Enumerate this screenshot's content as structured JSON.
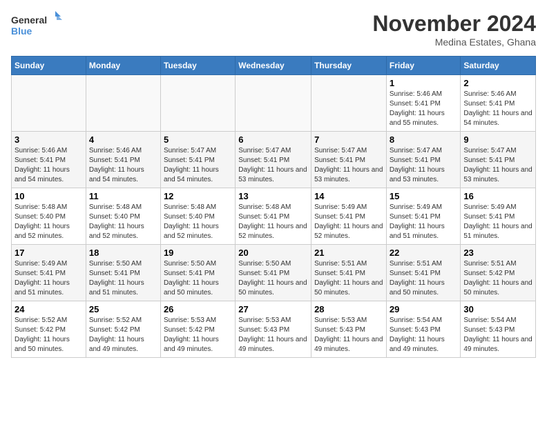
{
  "logo": {
    "line1": "General",
    "line2": "Blue"
  },
  "title": "November 2024",
  "subtitle": "Medina Estates, Ghana",
  "days_header": [
    "Sunday",
    "Monday",
    "Tuesday",
    "Wednesday",
    "Thursday",
    "Friday",
    "Saturday"
  ],
  "weeks": [
    [
      {
        "num": "",
        "info": ""
      },
      {
        "num": "",
        "info": ""
      },
      {
        "num": "",
        "info": ""
      },
      {
        "num": "",
        "info": ""
      },
      {
        "num": "",
        "info": ""
      },
      {
        "num": "1",
        "info": "Sunrise: 5:46 AM\nSunset: 5:41 PM\nDaylight: 11 hours and 55 minutes."
      },
      {
        "num": "2",
        "info": "Sunrise: 5:46 AM\nSunset: 5:41 PM\nDaylight: 11 hours and 54 minutes."
      }
    ],
    [
      {
        "num": "3",
        "info": "Sunrise: 5:46 AM\nSunset: 5:41 PM\nDaylight: 11 hours and 54 minutes."
      },
      {
        "num": "4",
        "info": "Sunrise: 5:46 AM\nSunset: 5:41 PM\nDaylight: 11 hours and 54 minutes."
      },
      {
        "num": "5",
        "info": "Sunrise: 5:47 AM\nSunset: 5:41 PM\nDaylight: 11 hours and 54 minutes."
      },
      {
        "num": "6",
        "info": "Sunrise: 5:47 AM\nSunset: 5:41 PM\nDaylight: 11 hours and 53 minutes."
      },
      {
        "num": "7",
        "info": "Sunrise: 5:47 AM\nSunset: 5:41 PM\nDaylight: 11 hours and 53 minutes."
      },
      {
        "num": "8",
        "info": "Sunrise: 5:47 AM\nSunset: 5:41 PM\nDaylight: 11 hours and 53 minutes."
      },
      {
        "num": "9",
        "info": "Sunrise: 5:47 AM\nSunset: 5:41 PM\nDaylight: 11 hours and 53 minutes."
      }
    ],
    [
      {
        "num": "10",
        "info": "Sunrise: 5:48 AM\nSunset: 5:40 PM\nDaylight: 11 hours and 52 minutes."
      },
      {
        "num": "11",
        "info": "Sunrise: 5:48 AM\nSunset: 5:40 PM\nDaylight: 11 hours and 52 minutes."
      },
      {
        "num": "12",
        "info": "Sunrise: 5:48 AM\nSunset: 5:40 PM\nDaylight: 11 hours and 52 minutes."
      },
      {
        "num": "13",
        "info": "Sunrise: 5:48 AM\nSunset: 5:41 PM\nDaylight: 11 hours and 52 minutes."
      },
      {
        "num": "14",
        "info": "Sunrise: 5:49 AM\nSunset: 5:41 PM\nDaylight: 11 hours and 52 minutes."
      },
      {
        "num": "15",
        "info": "Sunrise: 5:49 AM\nSunset: 5:41 PM\nDaylight: 11 hours and 51 minutes."
      },
      {
        "num": "16",
        "info": "Sunrise: 5:49 AM\nSunset: 5:41 PM\nDaylight: 11 hours and 51 minutes."
      }
    ],
    [
      {
        "num": "17",
        "info": "Sunrise: 5:49 AM\nSunset: 5:41 PM\nDaylight: 11 hours and 51 minutes."
      },
      {
        "num": "18",
        "info": "Sunrise: 5:50 AM\nSunset: 5:41 PM\nDaylight: 11 hours and 51 minutes."
      },
      {
        "num": "19",
        "info": "Sunrise: 5:50 AM\nSunset: 5:41 PM\nDaylight: 11 hours and 50 minutes."
      },
      {
        "num": "20",
        "info": "Sunrise: 5:50 AM\nSunset: 5:41 PM\nDaylight: 11 hours and 50 minutes."
      },
      {
        "num": "21",
        "info": "Sunrise: 5:51 AM\nSunset: 5:41 PM\nDaylight: 11 hours and 50 minutes."
      },
      {
        "num": "22",
        "info": "Sunrise: 5:51 AM\nSunset: 5:41 PM\nDaylight: 11 hours and 50 minutes."
      },
      {
        "num": "23",
        "info": "Sunrise: 5:51 AM\nSunset: 5:42 PM\nDaylight: 11 hours and 50 minutes."
      }
    ],
    [
      {
        "num": "24",
        "info": "Sunrise: 5:52 AM\nSunset: 5:42 PM\nDaylight: 11 hours and 50 minutes."
      },
      {
        "num": "25",
        "info": "Sunrise: 5:52 AM\nSunset: 5:42 PM\nDaylight: 11 hours and 49 minutes."
      },
      {
        "num": "26",
        "info": "Sunrise: 5:53 AM\nSunset: 5:42 PM\nDaylight: 11 hours and 49 minutes."
      },
      {
        "num": "27",
        "info": "Sunrise: 5:53 AM\nSunset: 5:43 PM\nDaylight: 11 hours and 49 minutes."
      },
      {
        "num": "28",
        "info": "Sunrise: 5:53 AM\nSunset: 5:43 PM\nDaylight: 11 hours and 49 minutes."
      },
      {
        "num": "29",
        "info": "Sunrise: 5:54 AM\nSunset: 5:43 PM\nDaylight: 11 hours and 49 minutes."
      },
      {
        "num": "30",
        "info": "Sunrise: 5:54 AM\nSunset: 5:43 PM\nDaylight: 11 hours and 49 minutes."
      }
    ]
  ]
}
